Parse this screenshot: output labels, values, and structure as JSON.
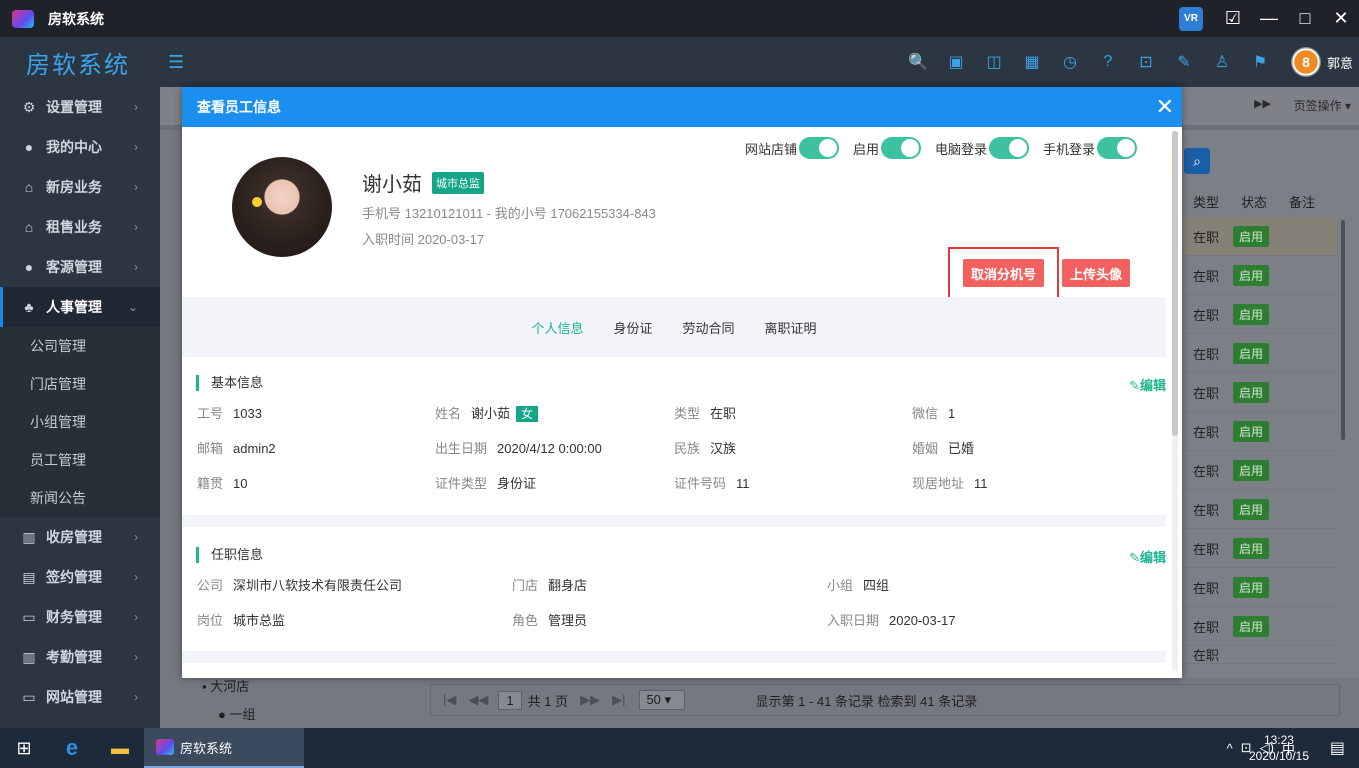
{
  "window": {
    "title": "房软系统",
    "vr_label": "VR",
    "minimize": "—",
    "maximize": "□",
    "close": "✕"
  },
  "header": {
    "brand": "房软系统",
    "toggle_icon": "☰",
    "user_name": "郭意",
    "user_avatar": "8"
  },
  "toolbar_icons": [
    "🔍",
    "▣",
    "◫",
    "▦",
    "◷",
    "?",
    "⊡",
    "✎",
    "♙",
    "⚑"
  ],
  "sidebar": {
    "items": [
      {
        "icon": "⚙",
        "label": "设置管理"
      },
      {
        "icon": "●",
        "label": "我的中心"
      },
      {
        "icon": "⌂",
        "label": "新房业务"
      },
      {
        "icon": "⌂",
        "label": "租售业务"
      },
      {
        "icon": "●",
        "label": "客源管理"
      },
      {
        "icon": "♣",
        "label": "人事管理",
        "active": true
      }
    ],
    "subitems": [
      "公司管理",
      "门店管理",
      "小组管理",
      "员工管理",
      "新闻公告"
    ],
    "items2": [
      {
        "icon": "▥",
        "label": "收房管理"
      },
      {
        "icon": "▤",
        "label": "签约管理"
      },
      {
        "icon": "▭",
        "label": "财务管理"
      },
      {
        "icon": "▥",
        "label": "考勤管理"
      },
      {
        "icon": "▭",
        "label": "网站管理"
      }
    ]
  },
  "tabstrip": {
    "page_ops": "页签操作 ▾",
    "forward": "▶▶"
  },
  "background_table": {
    "columns": [
      "类型",
      "状态",
      "备注"
    ],
    "rows": [
      {
        "type": "在职",
        "status": "启用"
      },
      {
        "type": "在职",
        "status": "启用"
      },
      {
        "type": "在职",
        "status": "启用"
      },
      {
        "type": "在职",
        "status": "启用"
      },
      {
        "type": "在职",
        "status": "启用"
      },
      {
        "type": "在职",
        "status": "启用"
      },
      {
        "type": "在职",
        "status": "启用"
      },
      {
        "type": "在职",
        "status": "启用"
      },
      {
        "type": "在职",
        "status": "启用"
      },
      {
        "type": "在职",
        "status": "启用"
      },
      {
        "type": "在职",
        "status": "启用"
      }
    ],
    "last_row_partial": "在职"
  },
  "tree": {
    "node1": "大河店",
    "node2": "一组"
  },
  "pager": {
    "page": "1",
    "total_pages_text": "共 1 页",
    "page_size": "50 ▾",
    "info": "显示第 1 - 41 条记录   检索到 41 条记录"
  },
  "modal": {
    "title": "查看员工信息",
    "close": "✕",
    "toggles": [
      {
        "label": "网站店铺"
      },
      {
        "label": "启用"
      },
      {
        "label": "电脑登录"
      },
      {
        "label": "手机登录"
      }
    ],
    "name": "谢小茹",
    "role": "城市总监",
    "phone_line": "手机号 13210121011 - 我的小号 17062155334-843",
    "join_line": "入职时间 2020-03-17",
    "btn_cancel_ext": "取消分机号",
    "btn_upload": "上传头像",
    "tabs": [
      "个人信息",
      "身份证",
      "劳动合同",
      "离职证明"
    ],
    "basic": {
      "title": "基本信息",
      "edit": "编辑",
      "fields": {
        "emp_no_label": "工号",
        "emp_no": "1033",
        "name_label": "姓名",
        "name": "谢小茹",
        "sex": "女",
        "type_label": "类型",
        "type": "在职",
        "wechat_label": "微信",
        "wechat": "1",
        "email_label": "邮箱",
        "email": "admin2",
        "birth_label": "出生日期",
        "birth": "2020/4/12 0:00:00",
        "ethnic_label": "民族",
        "ethnic": "汉族",
        "marriage_label": "婚姻",
        "marriage": "已婚",
        "native_label": "籍贯",
        "native": "10",
        "idtype_label": "证件类型",
        "idtype": "身份证",
        "idno_label": "证件号码",
        "idno": "11",
        "addr_label": "现居地址",
        "addr": "11"
      }
    },
    "job": {
      "title": "任职信息",
      "edit": "编辑",
      "fields": {
        "company_label": "公司",
        "company": "深圳市八软技术有限责任公司",
        "store_label": "门店",
        "store": "翻身店",
        "group_label": "小组",
        "group": "四组",
        "post_label": "岗位",
        "post": "城市总监",
        "rolefield_label": "角色",
        "rolefield": "管理员",
        "join_label": "入职日期",
        "join": "2020-03-17"
      }
    }
  },
  "taskbar": {
    "start": "⊞",
    "ie": "e",
    "folder": "▬",
    "app_label": "房软系统",
    "tray": [
      "^",
      "⊡",
      "◁)",
      "中"
    ],
    "time": "13:23",
    "date": "2020/10/15",
    "notif": "▤"
  },
  "colors": {
    "accent": "#1b8ff0",
    "green": "#1fb58f",
    "red_button": "#f26060",
    "sidebar": "#2b3642"
  }
}
